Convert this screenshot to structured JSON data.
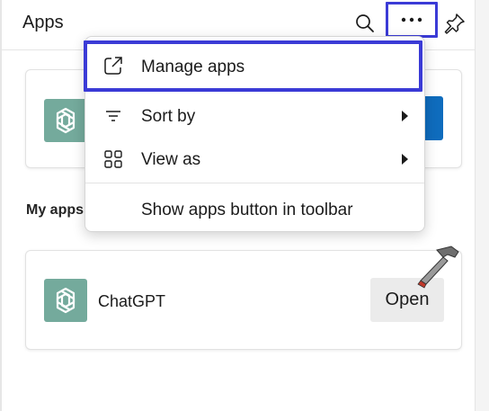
{
  "panel": {
    "title": "Apps",
    "icons": {
      "search": "search-icon",
      "more": "more-options-icon",
      "pin": "pin-icon"
    }
  },
  "sections": {
    "my_apps_label": "My apps"
  },
  "apps": [
    {
      "name": "ChatGPT",
      "open_label": "Open",
      "icon": "chatgpt-logo-icon"
    }
  ],
  "menu": {
    "items": [
      {
        "label": "Manage apps",
        "icon": "open-external-icon",
        "highlighted": true
      },
      {
        "label": "Sort by",
        "icon": "sort-icon",
        "submenu": true
      },
      {
        "label": "View as",
        "icon": "grid-view-icon",
        "submenu": true
      },
      {
        "label": "Show apps button in toolbar",
        "icon": ""
      }
    ]
  },
  "colors": {
    "accent_highlight": "#3b3bd6",
    "chatgpt_green": "#74aa9c",
    "primary_blue": "#0f6cbd",
    "open_button": "#ebebeb"
  }
}
